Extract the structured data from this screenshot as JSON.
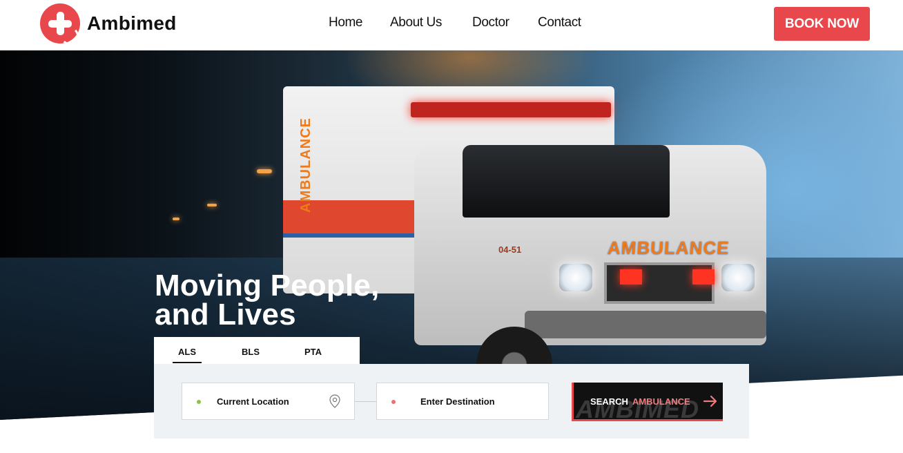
{
  "header": {
    "brand": "Ambimed",
    "nav": [
      "Home",
      "About Us",
      "Doctor",
      "Contact"
    ],
    "cta_label": "BOOK NOW"
  },
  "hero": {
    "headline_line1": "Moving People,",
    "headline_line2": "and Lives",
    "vehicle_side_text": "AMBULANCE",
    "vehicle_hood_text": "AMBULANCE",
    "vehicle_number": "04-51"
  },
  "booking": {
    "tabs": [
      "ALS",
      "BLS",
      "PTA"
    ],
    "active_tab": "ALS",
    "pickup_placeholder": "Current Location",
    "destination_placeholder": "Enter Destination",
    "search_label_main": "SEARCH",
    "search_label_accent": "AMBULANCE",
    "search_watermark": "AMBIMED"
  },
  "colors": {
    "brand_red": "#e8474b",
    "accent_pink": "#f07a7e",
    "panel_bg": "#eff2f5",
    "pickup_dot": "#8bc34a",
    "destination_dot": "#ef6f73"
  },
  "icons": {
    "logo": "medical-cross-icon",
    "pickup": "location-pin-icon",
    "search": "arrow-right-icon"
  }
}
